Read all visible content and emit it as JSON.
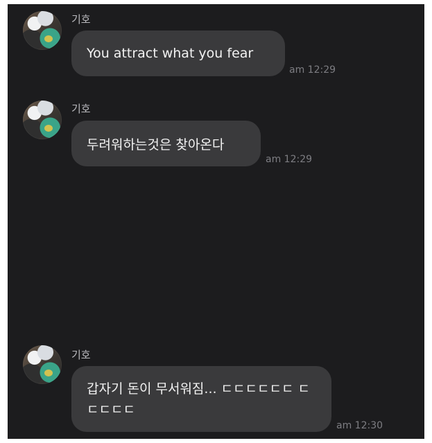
{
  "messages": [
    {
      "sender": "기호",
      "text": "You attract what you fear",
      "time": "am 12:29"
    },
    {
      "sender": "기호",
      "text": "두려워하는것은 찾아온다",
      "time": "am 12:29"
    },
    {
      "sender": "기호",
      "text": "갑자기 돈이 무서워짐... ㄷㄷㄷㄷㄷㄷ ㄷㄷㄷㄷㄷ",
      "time": "am 12:30"
    }
  ]
}
